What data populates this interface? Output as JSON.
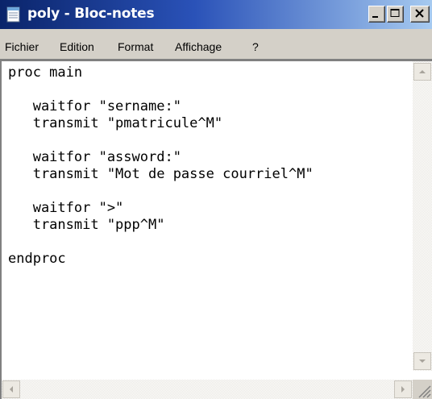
{
  "window": {
    "title": "poly - Bloc-notes",
    "icon": "notepad-icon",
    "controls": [
      "minimize-icon",
      "maximize-icon",
      "close-icon"
    ]
  },
  "menubar": {
    "items": [
      "Fichier",
      "Edition",
      "Format",
      "Affichage",
      "?"
    ]
  },
  "editor": {
    "content": "proc main\n\n   waitfor \"sername:\"\n   transmit \"pmatricule^M\"\n\n   waitfor \"assword:\"\n   transmit \"Mot de passe courriel^M\"\n\n   waitfor \">\"\n   transmit \"ppp^M\"\n\nendproc"
  },
  "scrollbars": {
    "vertical": [
      "up-arrow-icon",
      "down-arrow-icon"
    ],
    "horizontal": [
      "left-arrow-icon",
      "right-arrow-icon"
    ]
  },
  "colors": {
    "titlebar_start": "#0a246a",
    "titlebar_end": "#a6caf0",
    "chrome": "#d4d0c8",
    "editor_bg": "#ffffff"
  }
}
